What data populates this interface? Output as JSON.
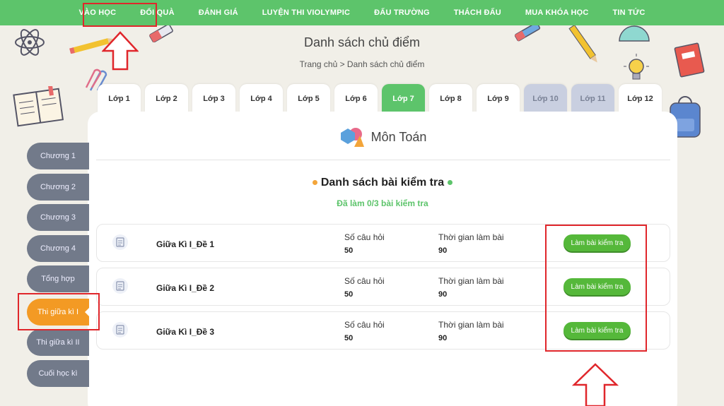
{
  "topnav": {
    "items": [
      "VÀO HỌC",
      "ĐỔI QUÀ",
      "ĐÁNH GIÁ",
      "LUYỆN THI VIOLYMPIC",
      "ĐẤU TRƯỜNG",
      "THÁCH ĐẤU",
      "MUA KHÓA HỌC",
      "TIN TỨC"
    ]
  },
  "page": {
    "title": "Danh sách chủ điểm",
    "breadcrumb": "Trang chủ > Danh sách chủ điểm"
  },
  "grades": [
    {
      "label": "Lớp 1",
      "state": "normal"
    },
    {
      "label": "Lớp 2",
      "state": "normal"
    },
    {
      "label": "Lớp 3",
      "state": "normal"
    },
    {
      "label": "Lớp 4",
      "state": "normal"
    },
    {
      "label": "Lớp 5",
      "state": "normal"
    },
    {
      "label": "Lớp 6",
      "state": "normal"
    },
    {
      "label": "Lớp 7",
      "state": "active"
    },
    {
      "label": "Lớp 8",
      "state": "normal"
    },
    {
      "label": "Lớp 9",
      "state": "normal"
    },
    {
      "label": "Lớp 10",
      "state": "disabled"
    },
    {
      "label": "Lớp 11",
      "state": "disabled"
    },
    {
      "label": "Lớp 12",
      "state": "normal"
    }
  ],
  "subject": {
    "label": "Môn Toán"
  },
  "tests": {
    "title": "Danh sách bài kiểm tra",
    "progress": "Đã làm 0/3 bài kiểm tra",
    "question_label": "Số câu hỏi",
    "time_label": "Thời gian làm bài",
    "button_label": "Làm bài kiểm tra",
    "items": [
      {
        "name": "Giữa Kì I_Đề 1",
        "questions": "50",
        "time": "90"
      },
      {
        "name": "Giữa Kì I_Đề 2",
        "questions": "50",
        "time": "90"
      },
      {
        "name": "Giữa Kì I_Đề 3",
        "questions": "50",
        "time": "90"
      }
    ]
  },
  "sidebar": {
    "items": [
      {
        "label": "Chương 1",
        "active": false
      },
      {
        "label": "Chương 2",
        "active": false
      },
      {
        "label": "Chương 3",
        "active": false
      },
      {
        "label": "Chương 4",
        "active": false
      },
      {
        "label": "Tổng hợp",
        "active": false
      },
      {
        "label": "Thi giữa kì I",
        "active": true
      },
      {
        "label": "Thi giữa kì II",
        "active": false
      },
      {
        "label": "Cuối học kì",
        "active": false
      }
    ]
  },
  "colors": {
    "brand_green": "#5dc46b",
    "active_orange": "#f39a24",
    "annotation_red": "#e0262b"
  }
}
